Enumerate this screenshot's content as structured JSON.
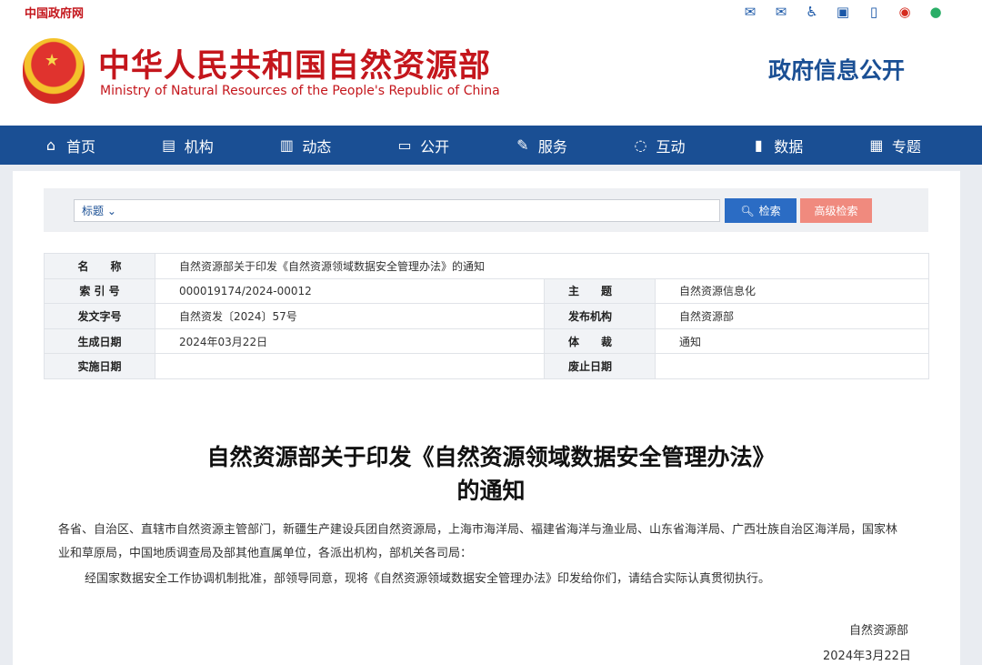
{
  "topbar": {
    "gov_link": "中国政府网",
    "icons": [
      "mail-icon",
      "mail-alt-icon",
      "accessibility-icon",
      "app-icon",
      "mobile-icon",
      "weibo-icon",
      "wechat-icon"
    ]
  },
  "header": {
    "cn_title": "中华人民共和国自然资源部",
    "en_title": "Ministry of Natural Resources of the People's Republic of China",
    "info_open": "政府信息公开"
  },
  "nav": {
    "items": [
      {
        "label": "首页",
        "icon": "home-icon"
      },
      {
        "label": "机构",
        "icon": "org-icon"
      },
      {
        "label": "动态",
        "icon": "book-icon"
      },
      {
        "label": "公开",
        "icon": "monitor-icon"
      },
      {
        "label": "服务",
        "icon": "edit-icon"
      },
      {
        "label": "互动",
        "icon": "chat-icon"
      },
      {
        "label": "数据",
        "icon": "bar-chart-icon"
      },
      {
        "label": "专题",
        "icon": "topic-icon"
      }
    ]
  },
  "search": {
    "scope": "标题",
    "search_label": "检索",
    "advanced_label": "高级检索"
  },
  "meta": {
    "name_key": "名　　称",
    "name_val": "自然资源部关于印发《自然资源领域数据安全管理办法》的通知",
    "index_key": "索 引 号",
    "index_val": "000019174/2024-00012",
    "topic_key": "主　　题",
    "topic_val": "自然资源信息化",
    "doc_key": "发文字号",
    "doc_val": "自然资发〔2024〕57号",
    "issuer_key": "发布机构",
    "issuer_val": "自然资源部",
    "date_key": "生成日期",
    "date_val": "2024年03月22日",
    "genre_key": "体　　裁",
    "genre_val": "通知",
    "effective_key": "实施日期",
    "effective_val": "",
    "abolish_key": "废止日期",
    "abolish_val": ""
  },
  "article": {
    "title_line1": "自然资源部关于印发《自然资源领域数据安全管理办法》",
    "title_line2": "的通知",
    "recipients": "各省、自治区、直辖市自然资源主管部门，新疆生产建设兵团自然资源局，上海市海洋局、福建省海洋与渔业局、山东省海洋局、广西壮族自治区海洋局，国家林业和草原局，中国地质调查局及部其他直属单位，各派出机构，部机关各司局：",
    "body": "经国家数据安全工作协调机制批准，部领导同意，现将《自然资源领域数据安全管理办法》印发给你们，请结合实际认真贯彻执行。",
    "sign_org": "自然资源部",
    "sign_date": "2024年3月22日"
  }
}
